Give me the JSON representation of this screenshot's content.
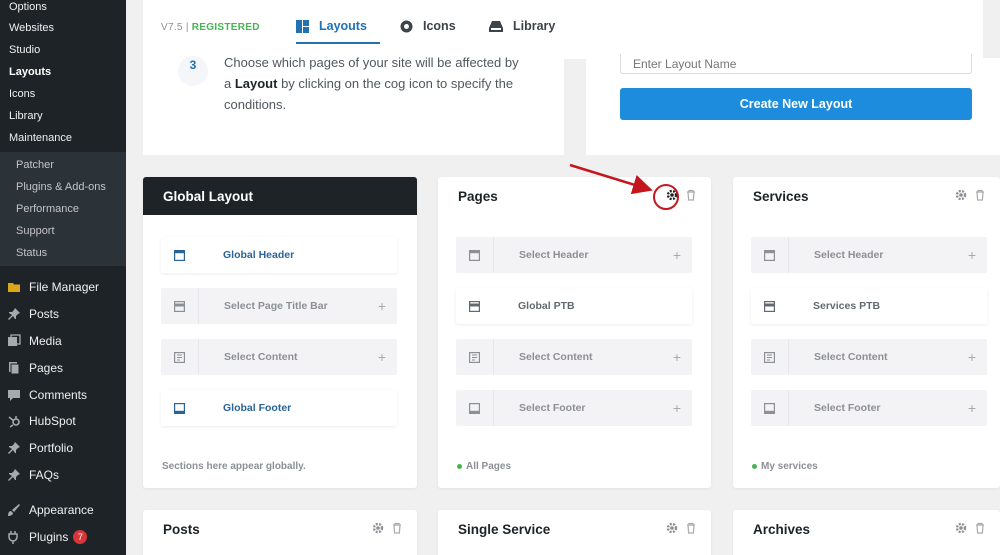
{
  "sidebar": {
    "top_items": [
      {
        "label": "Options"
      },
      {
        "label": "Websites"
      },
      {
        "label": "Studio"
      },
      {
        "label": "Layouts"
      },
      {
        "label": "Icons"
      },
      {
        "label": "Library"
      },
      {
        "label": "Maintenance"
      }
    ],
    "lower_items": [
      {
        "label": "Patcher"
      },
      {
        "label": "Plugins & Add-ons"
      },
      {
        "label": "Performance"
      },
      {
        "label": "Support"
      },
      {
        "label": "Status"
      }
    ],
    "menu": [
      {
        "label": "File Manager",
        "icon": "folder-icon"
      },
      {
        "label": "Posts",
        "icon": "pin-icon"
      },
      {
        "label": "Media",
        "icon": "media-icon"
      },
      {
        "label": "Pages",
        "icon": "pages-icon"
      },
      {
        "label": "Comments",
        "icon": "comment-icon"
      },
      {
        "label": "HubSpot",
        "icon": "hubspot-icon"
      },
      {
        "label": "Portfolio",
        "icon": "pin-icon"
      },
      {
        "label": "FAQs",
        "icon": "pin-icon"
      },
      {
        "label": "Appearance",
        "icon": "brush-icon"
      },
      {
        "label": "Plugins",
        "icon": "plug-icon",
        "badge": "7"
      }
    ]
  },
  "header": {
    "version": "V7.5 |",
    "registered": "REGISTERED",
    "tabs": [
      {
        "label": "Layouts",
        "icon": "layouts-icon"
      },
      {
        "label": "Icons",
        "icon": "icons-icon"
      },
      {
        "label": "Library",
        "icon": "library-icon"
      }
    ]
  },
  "step": {
    "number": "3",
    "line1": "Choose which pages of your site will be affected by",
    "pre": "a ",
    "bold": "Layout",
    "post": " by clicking on the cog icon to specify the",
    "line3": "conditions."
  },
  "create": {
    "placeholder": "Enter Layout Name",
    "button": "Create New Layout"
  },
  "cards": {
    "global": {
      "title": "Global Layout",
      "rows": [
        "Global Header",
        "Select Page Title Bar",
        "Select Content",
        "Global Footer"
      ],
      "footer": "Sections here appear globally."
    },
    "pages": {
      "title": "Pages",
      "rows": [
        "Select Header",
        "Global PTB",
        "Select Content",
        "Select Footer"
      ],
      "footer": "All Pages"
    },
    "services": {
      "title": "Services",
      "rows": [
        "Select Header",
        "Services PTB",
        "Select Content",
        "Select Footer"
      ],
      "footer": "My services"
    },
    "posts": {
      "title": "Posts"
    },
    "single_service": {
      "title": "Single Service"
    },
    "archives": {
      "title": "Archives"
    }
  },
  "colors": {
    "sidebar_bg": "#1d2327",
    "accent": "#1e8cdc",
    "registered": "#46b450",
    "annotation": "#c5161d"
  }
}
